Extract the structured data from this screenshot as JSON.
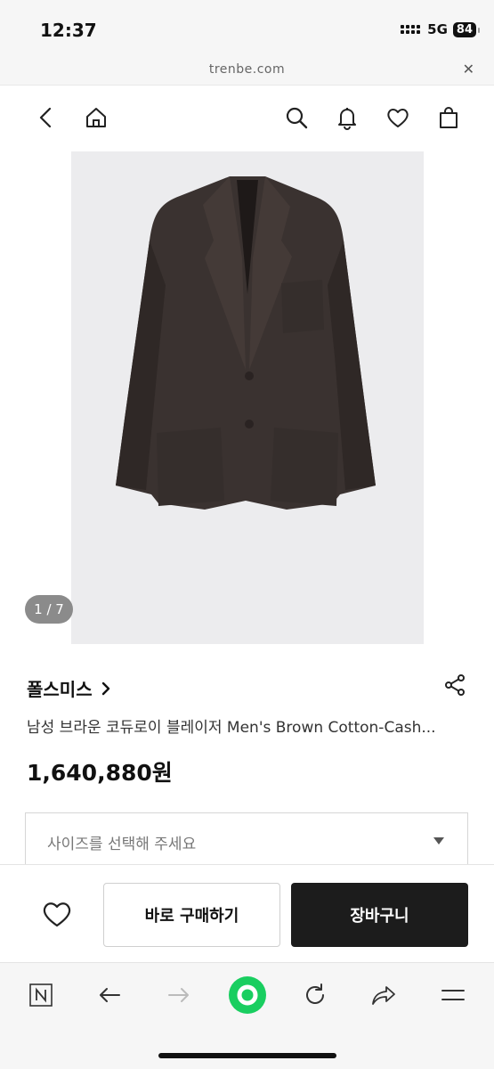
{
  "status_bar": {
    "time": "12:37",
    "network": "5G",
    "battery": "84"
  },
  "url_bar": {
    "url": "trenbe.com",
    "close_icon": "close-icon"
  },
  "nav": {
    "icons": [
      "back-icon",
      "home-icon",
      "search-icon",
      "bell-icon",
      "heart-icon",
      "shopping-bag-icon"
    ]
  },
  "product": {
    "image_counter": "1 / 7",
    "brand": "폴스미스",
    "title": "남성 브라운 코듀로이 블레이저 Men's Brown Cotton-Cash...",
    "price": "1,640,880원"
  },
  "size_select": {
    "placeholder": "사이즈를 선택해 주세요"
  },
  "actions": {
    "buy_now": "바로 구매하기",
    "add_to_cart": "장바구니"
  },
  "browser_toolbar": {
    "icons": [
      "naver-n-icon",
      "back-arrow-icon",
      "forward-arrow-icon",
      "green-dot-icon",
      "refresh-icon",
      "share-arrow-icon",
      "menu-icon"
    ]
  },
  "colors": {
    "accent_green": "#19ce60",
    "dark_button": "#1c1c1c",
    "image_bg": "#ececee"
  }
}
